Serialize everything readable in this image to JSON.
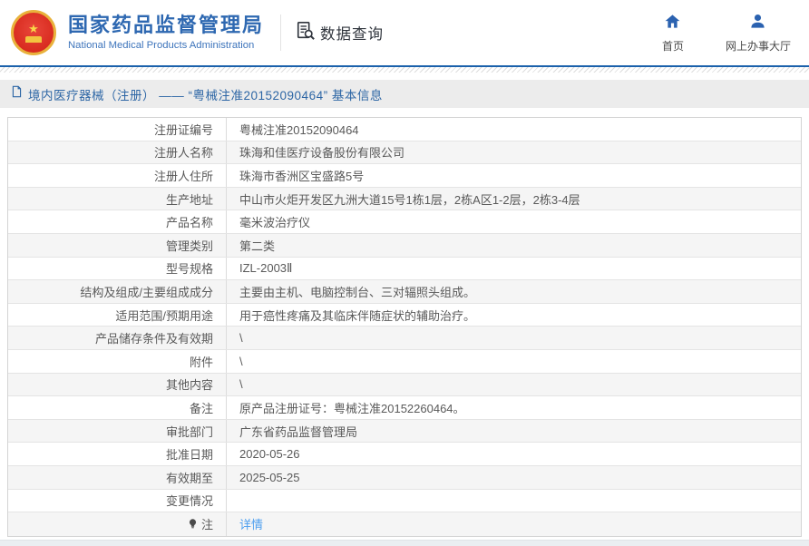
{
  "header": {
    "org_name": "国家药品监督管理局",
    "org_name_en": "National Medical Products Administration",
    "section_label": "数据查询",
    "nav": [
      {
        "label": "首页",
        "icon": "home-icon"
      },
      {
        "label": "网上办事大厅",
        "icon": "user-icon"
      }
    ]
  },
  "breadcrumb": {
    "text": "境内医疗器械（注册） —— “粤械注准20152090464” 基本信息"
  },
  "table": {
    "rows": [
      {
        "label": "注册证编号",
        "value": "粤械注准20152090464"
      },
      {
        "label": "注册人名称",
        "value": "珠海和佳医疗设备股份有限公司"
      },
      {
        "label": "注册人住所",
        "value": "珠海市香洲区宝盛路5号"
      },
      {
        "label": "生产地址",
        "value": "中山市火炬开发区九洲大道15号1栋1层，2栋A区1-2层，2栋3-4层"
      },
      {
        "label": "产品名称",
        "value": "毫米波治疗仪"
      },
      {
        "label": "管理类别",
        "value": "第二类"
      },
      {
        "label": "型号规格",
        "value": "IZL-2003Ⅱ"
      },
      {
        "label": "结构及组成/主要组成成分",
        "value": "主要由主机、电脑控制台、三对辐照头组成。"
      },
      {
        "label": "适用范围/预期用途",
        "value": "用于癌性疼痛及其临床伴随症状的辅助治疗。"
      },
      {
        "label": "产品储存条件及有效期",
        "value": "\\"
      },
      {
        "label": "附件",
        "value": "\\"
      },
      {
        "label": "其他内容",
        "value": "\\"
      },
      {
        "label": "备注",
        "value": "原产品注册证号：粤械注准20152260464。"
      },
      {
        "label": "审批部门",
        "value": "广东省药品监督管理局"
      },
      {
        "label": "批准日期",
        "value": "2020-05-26"
      },
      {
        "label": "有效期至",
        "value": "2025-05-25"
      },
      {
        "label": "变更情况",
        "value": ""
      },
      {
        "label": "注",
        "value": "详情",
        "link": true,
        "icon": "lightbulb-icon"
      }
    ]
  },
  "colors": {
    "brand_blue": "#2e68b1",
    "divider_blue": "#1b61ab",
    "link_blue": "#4d9fef",
    "breadcrumb_bg": "#ececec",
    "zebra_row": "#f5f5f5",
    "emblem_red": "#d92c20",
    "emblem_gold": "#e9b23c"
  }
}
